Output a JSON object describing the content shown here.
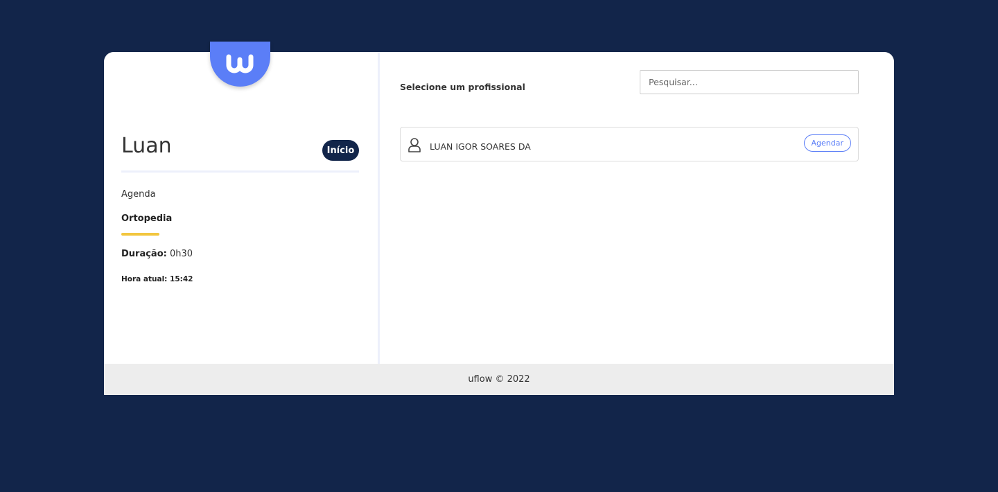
{
  "brand": {
    "logo_icon": "uflow-w-logo-icon",
    "accent": "#5b7ef7",
    "dark": "#12254a",
    "highlight": "#f2c63f"
  },
  "sidebar": {
    "user_name": "Luan",
    "home_button": "Início",
    "agenda_label": "Agenda",
    "specialty": "Ortopedia",
    "duration_label": "Duração:",
    "duration_value": "0h30",
    "current_time": "Hora atual: 15:42"
  },
  "main": {
    "title": "Selecione um profissional",
    "search": {
      "placeholder": "Pesquisar..."
    },
    "professionals": [
      {
        "icon": "user-icon",
        "name": "LUAN IGOR SOARES DA",
        "action": "Agendar"
      }
    ]
  },
  "footer": {
    "text": "uflow © 2022"
  }
}
